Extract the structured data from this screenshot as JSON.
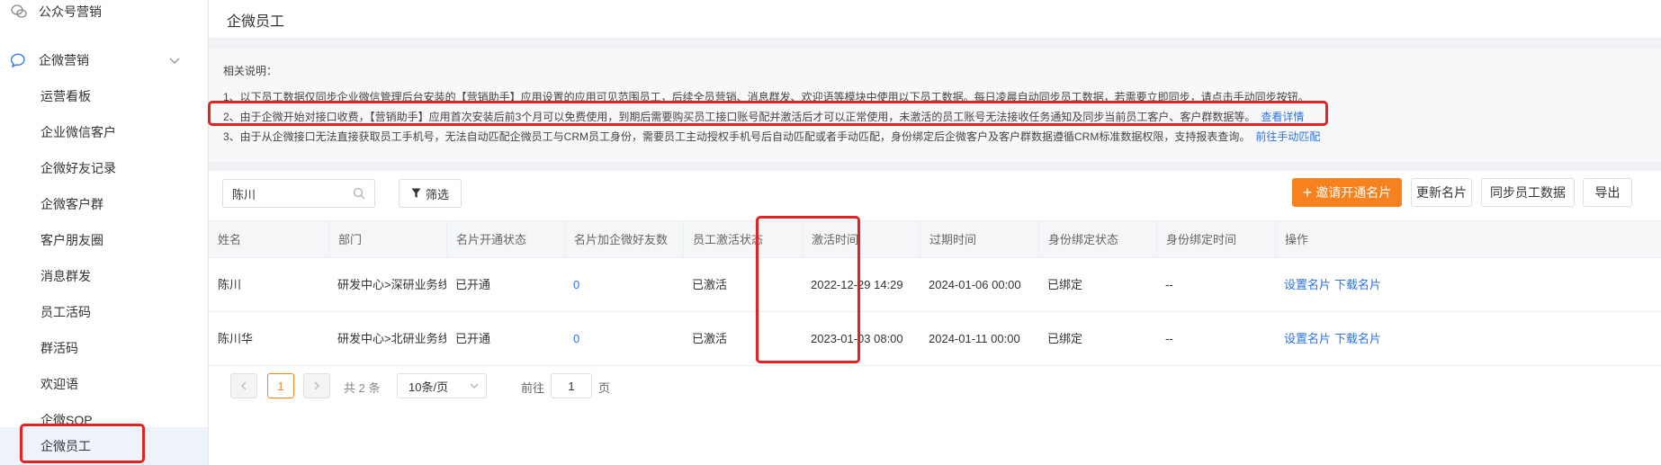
{
  "sidebar": {
    "items": [
      {
        "label": "公众号营销"
      },
      {
        "label": "企微营销"
      },
      {
        "label": "运营看板"
      },
      {
        "label": "企业微信客户"
      },
      {
        "label": "企微好友记录"
      },
      {
        "label": "企微客户群"
      },
      {
        "label": "客户朋友圈"
      },
      {
        "label": "消息群发"
      },
      {
        "label": "员工活码"
      },
      {
        "label": "群活码"
      },
      {
        "label": "欢迎语"
      },
      {
        "label": "企微SOP"
      },
      {
        "label": "企微员工"
      }
    ]
  },
  "page": {
    "title": "企微员工"
  },
  "notes": {
    "heading": "相关说明：",
    "line1": "1、以下员工数据仅同步企业微信管理后台安装的【营销助手】应用设置的应用可见范围员工，后续全员营销、消息群发、欢迎语等模块中使用以下员工数据。每日凌晨自动同步员工数据，若需要立即同步，请点击手动同步按钮。",
    "line2": "2、由于企微开始对接口收费，【营销助手】应用首次安装后前3个月可以免费使用，到期后需要购买员工接口账号配并激活后才可以正常使用，未激活的员工账号无法接收任务通知及同步当前员工客户、客户群数据等。",
    "line2_link": "查看详情",
    "line3": "3、由于从企微接口无法直接获取员工手机号，无法自动匹配企微员工与CRM员工身份，需要员工主动授权手机号后自动匹配或者手动匹配，身份绑定后企微客户及客户群数据遵循CRM标准数据权限，支持报表查询。",
    "line3_link": "前往手动匹配"
  },
  "toolbar": {
    "search_value": "陈川",
    "filter_label": "筛选",
    "invite_label": "邀请开通名片",
    "update_label": "更新名片",
    "sync_label": "同步员工数据",
    "export_label": "导出"
  },
  "table": {
    "columns": [
      "姓名",
      "部门",
      "名片开通状态",
      "名片加企微好友数",
      "员工激活状态",
      "激活时间",
      "过期时间",
      "身份绑定状态",
      "身份绑定时间",
      "操作"
    ],
    "rows": [
      {
        "name": "陈川",
        "dept": "研发中心>深研业务线...",
        "card_status": "已开通",
        "friends": "0",
        "activation": "已激活",
        "activated_at": "2022-12-29 14:29",
        "expires_at": "2024-01-06 00:00",
        "bind_status": "已绑定",
        "bind_time": "--",
        "action_set": "设置名片",
        "action_download": "下载名片"
      },
      {
        "name": "陈川华",
        "dept": "研发中心>北研业务线...",
        "card_status": "已开通",
        "friends": "0",
        "activation": "已激活",
        "activated_at": "2023-01-03 08:00",
        "expires_at": "2024-01-11 00:00",
        "bind_status": "已绑定",
        "bind_time": "--",
        "action_set": "设置名片",
        "action_download": "下载名片"
      }
    ]
  },
  "pagination": {
    "current": "1",
    "total_text": "共 2 条",
    "page_size": "10条/页",
    "goto_label": "前往",
    "goto_value": "1",
    "page_suffix": "页"
  },
  "colors": {
    "accent": "#f7811f",
    "link": "#2b73e3",
    "annotation": "#e52222"
  }
}
